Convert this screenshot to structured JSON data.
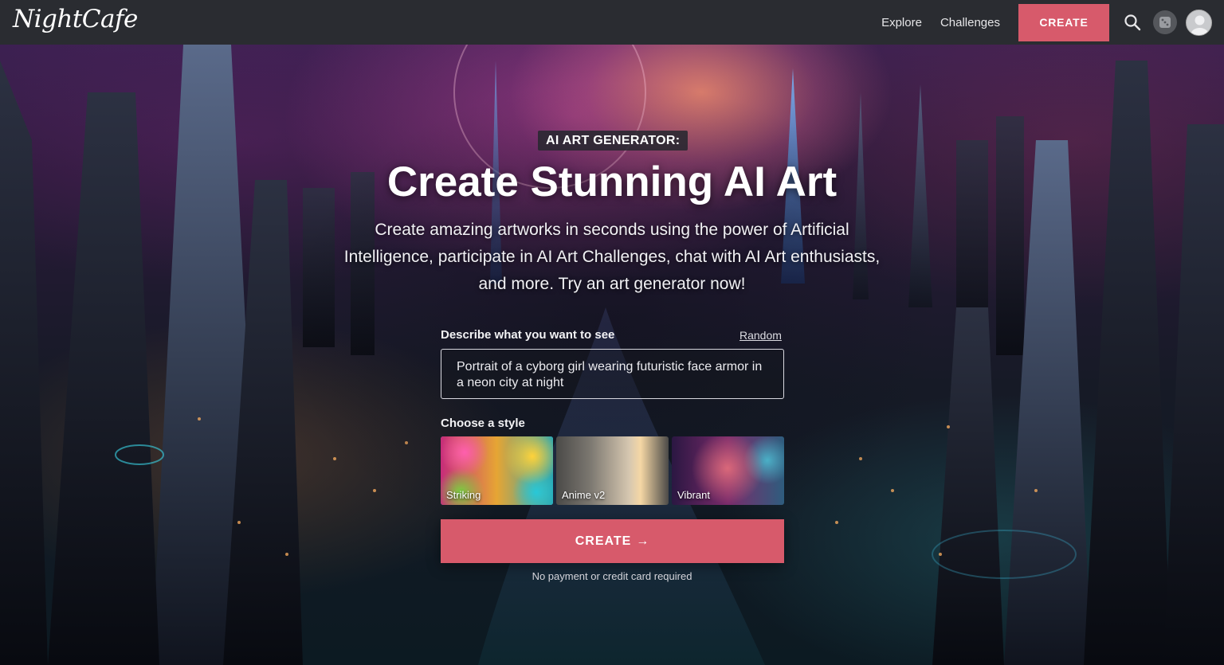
{
  "header": {
    "logo": "NightCafe",
    "nav": [
      {
        "label": "Explore"
      },
      {
        "label": "Challenges"
      }
    ],
    "create_label": "CREATE",
    "icons": [
      "search-icon",
      "dice-icon",
      "avatar"
    ]
  },
  "hero": {
    "badge": "AI ART GENERATOR:",
    "title": "Create Stunning AI Art",
    "subtitle": "Create amazing artworks in seconds using the power of Artificial Intelligence, participate in AI Art Challenges, chat with AI Art enthusiasts, and more. Try an art generator now!",
    "prompt_label": "Describe what you want to see",
    "random_label": "Random",
    "prompt_value": "Portrait of a cyborg girl wearing futuristic face armor in a neon city at night",
    "style_label": "Choose a style",
    "styles": [
      {
        "name": "Striking",
        "selected": true
      },
      {
        "name": "Anime v2",
        "selected": false
      },
      {
        "name": "Vibrant",
        "selected": false
      }
    ],
    "create_label": "CREATE",
    "create_arrow": "→",
    "note": "No payment or credit card required"
  },
  "colors": {
    "accent": "#d75a6b",
    "topbar": "#2a2c31",
    "selected_outline": "#6fa8e8"
  }
}
